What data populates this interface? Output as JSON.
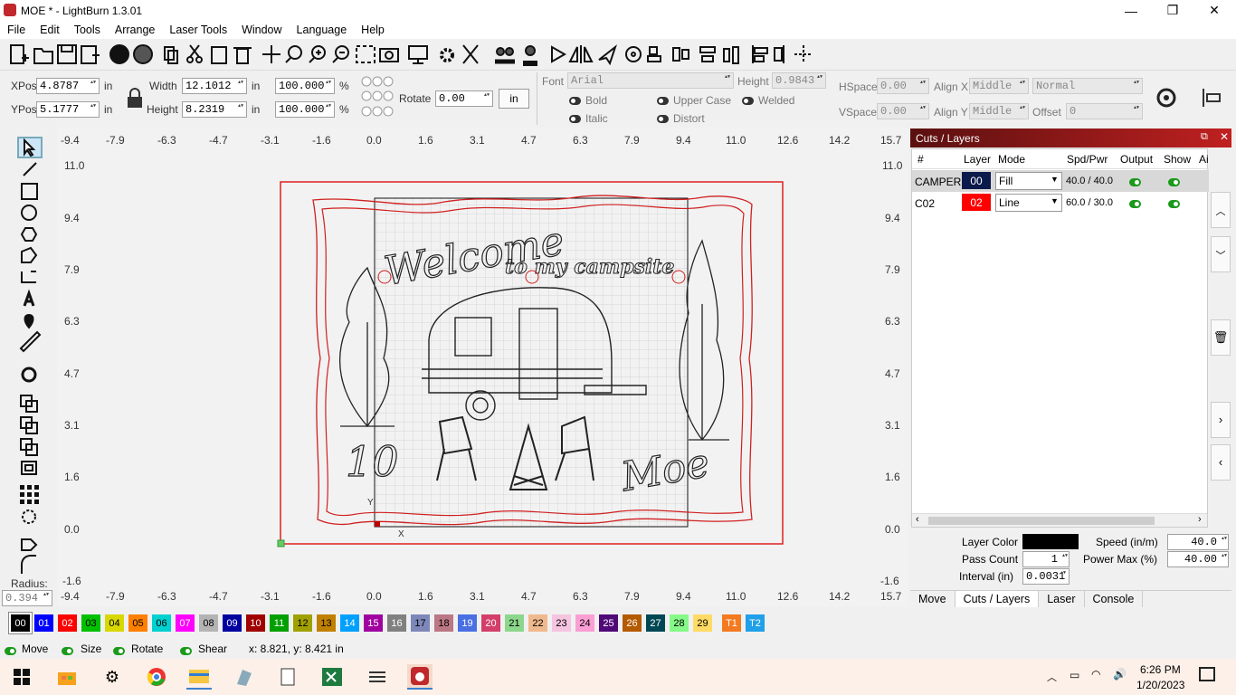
{
  "window": {
    "title": "MOE * - LightBurn 1.3.01",
    "min": "—",
    "max": "❐",
    "close": "✕"
  },
  "menu": [
    "File",
    "Edit",
    "Tools",
    "Arrange",
    "Laser Tools",
    "Window",
    "Language",
    "Help"
  ],
  "position": {
    "xpos_label": "XPos",
    "xpos": "4.8787",
    "ypos_label": "YPos",
    "ypos": "5.1777",
    "unit": "in"
  },
  "size": {
    "width_label": "Width",
    "width": "12.1012",
    "height_label": "Height",
    "height": "8.2319",
    "unit": "in",
    "w_pct": "100.000",
    "h_pct": "100.000",
    "pct": "%"
  },
  "rotate": {
    "label": "Rotate",
    "value": "0.00",
    "unit_button": "in"
  },
  "font": {
    "label": "Font",
    "value": "Arial",
    "height_label": "Height",
    "height": "0.9843",
    "bold": "Bold",
    "italic": "Italic",
    "upper": "Upper Case",
    "distort": "Distort",
    "welded": "Welded"
  },
  "spacing": {
    "hspace_label": "HSpace",
    "hspace": "0.00",
    "vspace_label": "VSpace",
    "vspace": "0.00",
    "alignx_label": "Align X",
    "alignx": "Middle",
    "aligny_label": "Align Y",
    "aligny": "Middle",
    "mode": "Normal",
    "offset_label": "Offset",
    "offset": "0"
  },
  "ruler": {
    "top": [
      "-9.4",
      "-7.9",
      "-6.3",
      "-4.7",
      "-3.1",
      "-1.6",
      "0.0",
      "1.6",
      "3.1",
      "4.7",
      "6.3",
      "7.9",
      "9.4",
      "11.0",
      "12.6",
      "14.2",
      "15.7"
    ],
    "left": [
      "11.0",
      "9.4",
      "7.9",
      "6.3",
      "4.7",
      "3.1",
      "1.6",
      "0.0",
      "-1.6"
    ]
  },
  "design": {
    "welcome": "Welcome",
    "campsite": "to my campsite",
    "number": "10",
    "name": "Moe",
    "axis_x": "X",
    "axis_y": "Y"
  },
  "left_tools": {
    "radius_label": "Radius:",
    "radius": "0.394"
  },
  "cuts": {
    "title": "Cuts / Layers",
    "headers": [
      "#",
      "Layer",
      "Mode",
      "Spd/Pwr",
      "Output",
      "Show",
      "Ai"
    ],
    "rows": [
      {
        "name": "CAMPER",
        "layer": "00",
        "color": "#0a1a4a",
        "mode": "Fill",
        "spd": "40.0 / 40.0"
      },
      {
        "name": "C02",
        "layer": "02",
        "color": "#ff0000",
        "mode": "Line",
        "spd": "60.0 / 30.0"
      }
    ],
    "layer_color_label": "Layer Color",
    "speed_label": "Speed (in/m)",
    "speed": "40.0",
    "pass_label": "Pass Count",
    "pass": "1",
    "power_label": "Power Max (%)",
    "power": "40.00",
    "interval_label": "Interval (in)",
    "interval": "0.0031"
  },
  "tabs": [
    "Move",
    "Cuts / Layers",
    "Laser",
    "Console"
  ],
  "palette": [
    {
      "t": "00",
      "c": "#000000",
      "f": "#fff"
    },
    {
      "t": "01",
      "c": "#0000ff",
      "f": "#fff"
    },
    {
      "t": "02",
      "c": "#ff0000",
      "f": "#fff"
    },
    {
      "t": "03",
      "c": "#00c000",
      "f": "#000"
    },
    {
      "t": "04",
      "c": "#d8d800",
      "f": "#000"
    },
    {
      "t": "05",
      "c": "#ff8000",
      "f": "#000"
    },
    {
      "t": "06",
      "c": "#00d0d0",
      "f": "#000"
    },
    {
      "t": "07",
      "c": "#ff00ff",
      "f": "#fff"
    },
    {
      "t": "08",
      "c": "#b4b4b4",
      "f": "#000"
    },
    {
      "t": "09",
      "c": "#0000a0",
      "f": "#fff"
    },
    {
      "t": "10",
      "c": "#a00000",
      "f": "#fff"
    },
    {
      "t": "11",
      "c": "#00a000",
      "f": "#fff"
    },
    {
      "t": "12",
      "c": "#a0a000",
      "f": "#000"
    },
    {
      "t": "13",
      "c": "#c08000",
      "f": "#000"
    },
    {
      "t": "14",
      "c": "#00a0ff",
      "f": "#fff"
    },
    {
      "t": "15",
      "c": "#a000a0",
      "f": "#fff"
    },
    {
      "t": "16",
      "c": "#808080",
      "f": "#fff"
    },
    {
      "t": "17",
      "c": "#7d87b9",
      "f": "#000"
    },
    {
      "t": "18",
      "c": "#bb7784",
      "f": "#000"
    },
    {
      "t": "19",
      "c": "#4a6fe3",
      "f": "#fff"
    },
    {
      "t": "20",
      "c": "#d33f6a",
      "f": "#fff"
    },
    {
      "t": "21",
      "c": "#8cd78c",
      "f": "#000"
    },
    {
      "t": "22",
      "c": "#f0b98d",
      "f": "#000"
    },
    {
      "t": "23",
      "c": "#f6c4e1",
      "f": "#000"
    },
    {
      "t": "24",
      "c": "#fa9ed4",
      "f": "#000"
    },
    {
      "t": "25",
      "c": "#500a78",
      "f": "#fff"
    },
    {
      "t": "26",
      "c": "#b45a00",
      "f": "#fff"
    },
    {
      "t": "27",
      "c": "#004754",
      "f": "#fff"
    },
    {
      "t": "28",
      "c": "#86fa88",
      "f": "#000"
    },
    {
      "t": "29",
      "c": "#ffdb66",
      "f": "#000"
    },
    {
      "t": "T1",
      "c": "#f37a20",
      "f": "#fff"
    },
    {
      "t": "T2",
      "c": "#1fa0e8",
      "f": "#fff"
    }
  ],
  "status": {
    "move": "Move",
    "size": "Size",
    "rotate": "Rotate",
    "shear": "Shear",
    "coords": "x: 8.821, y: 8.421 in"
  },
  "taskbar": {
    "time": "6:26 PM",
    "date": "1/20/2023"
  }
}
